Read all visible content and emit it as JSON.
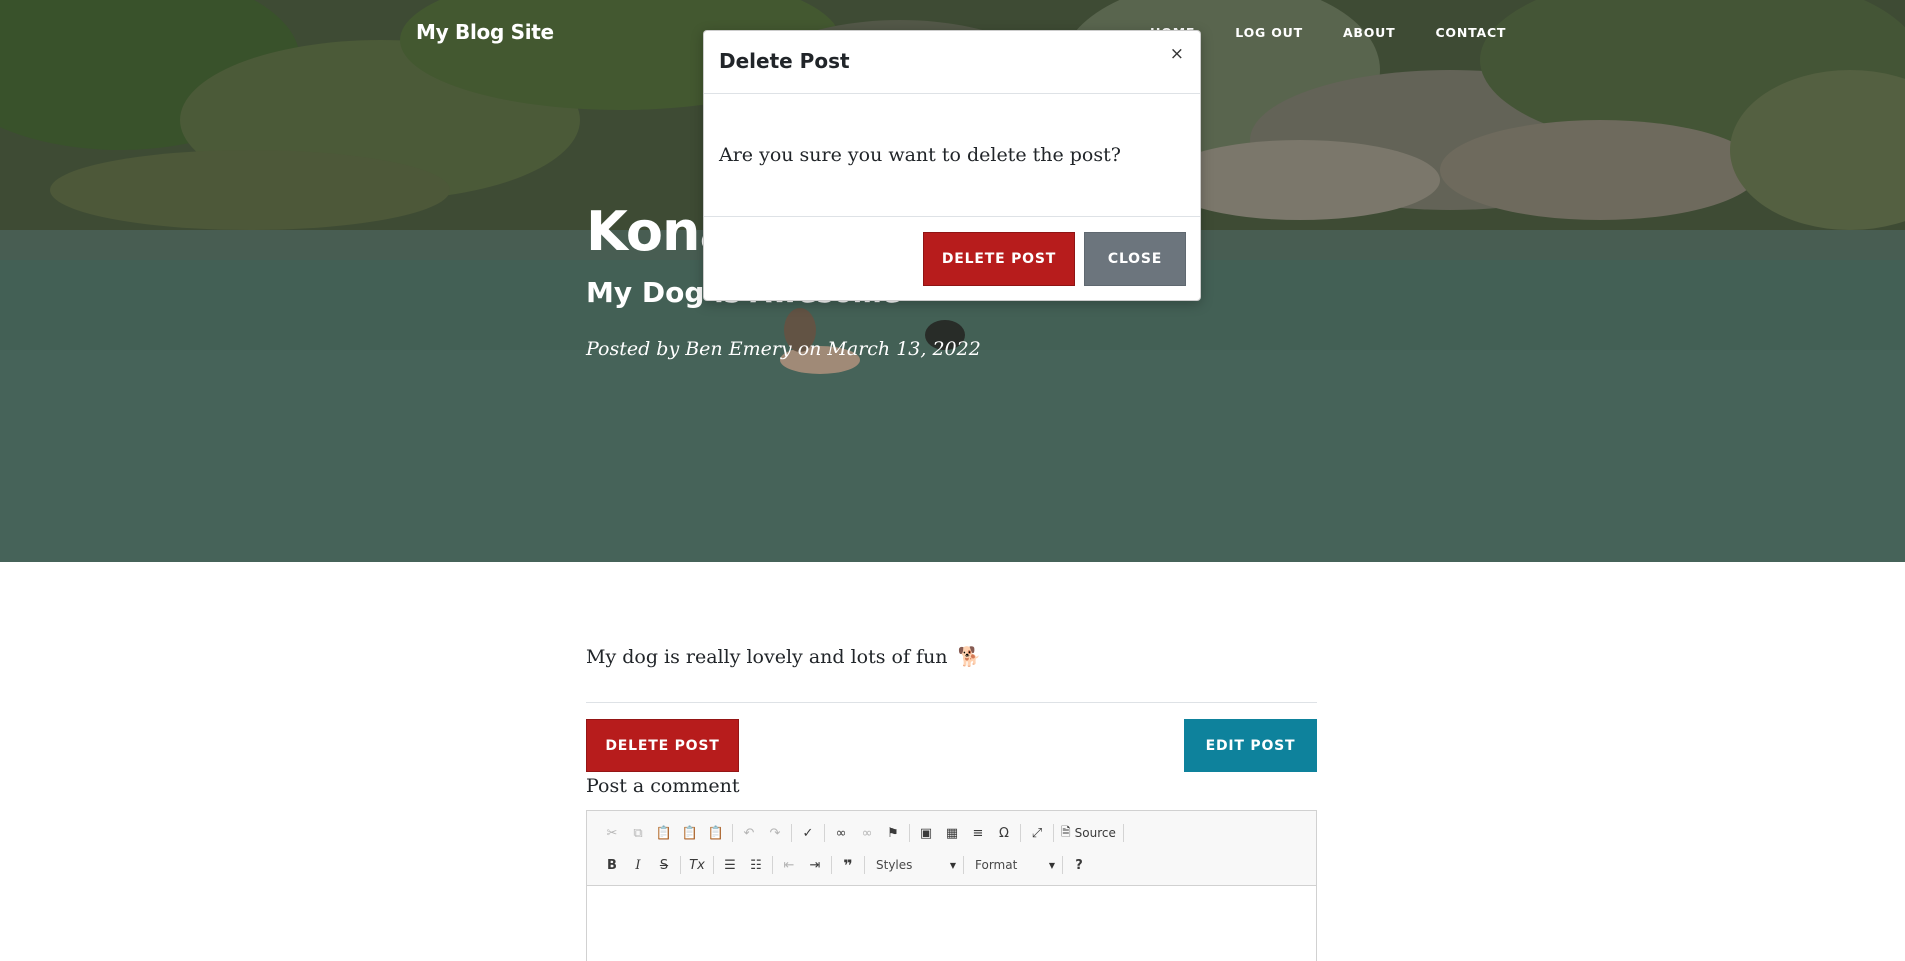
{
  "nav": {
    "brand": "My Blog Site",
    "links": [
      "HOME",
      "LOG OUT",
      "ABOUT",
      "CONTACT"
    ]
  },
  "post": {
    "title": "Kona",
    "subtitle": "My Dog is Awesome",
    "meta": "Posted by Ben Emery on March 13, 2022",
    "body": "My dog is really lovely and lots of fun",
    "body_emoji": "🐕",
    "delete_label": "DELETE POST",
    "edit_label": "EDIT POST"
  },
  "comment": {
    "label": "Post a comment"
  },
  "editor": {
    "source_label": "Source",
    "styles_label": "Styles",
    "format_label": "Format",
    "help_label": "?"
  },
  "modal": {
    "title": "Delete Post",
    "close_glyph": "×",
    "message": "Are you sure you want to delete the post?",
    "confirm_label": "DELETE POST",
    "cancel_label": "CLOSE"
  },
  "colors": {
    "danger": "#b71c1c",
    "info": "#0e829c",
    "secondary": "#6c757d"
  }
}
